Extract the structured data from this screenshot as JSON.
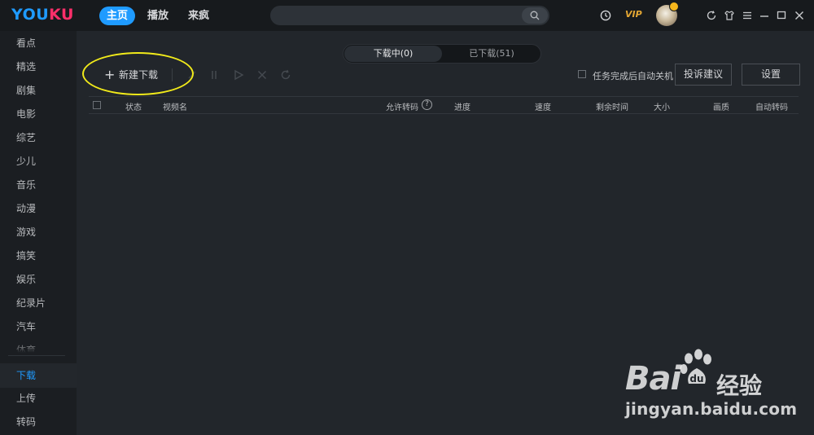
{
  "app": {
    "logo_left": "YOU",
    "logo_right": "KU",
    "brand_blue": "#1f9bff",
    "brand_pink": "#ff2f6a"
  },
  "topnav": {
    "items": [
      {
        "label": "主页",
        "active": true
      },
      {
        "label": "播放",
        "active": false
      },
      {
        "label": "来疯",
        "active": false
      }
    ]
  },
  "search": {
    "placeholder": "",
    "icon": "search-icon"
  },
  "toolbar_right": {
    "history_icon": "clock-icon",
    "vip_label": "VIP",
    "avatar_icon": "avatar",
    "window_icons": [
      "refresh-icon",
      "skin-icon",
      "menu-icon",
      "minimize-icon",
      "maximize-icon",
      "close-icon"
    ]
  },
  "sidebar": {
    "items": [
      {
        "label": "看点"
      },
      {
        "label": "精选"
      },
      {
        "label": "剧集"
      },
      {
        "label": "电影"
      },
      {
        "label": "综艺"
      },
      {
        "label": "少儿"
      },
      {
        "label": "音乐"
      },
      {
        "label": "动漫"
      },
      {
        "label": "游戏"
      },
      {
        "label": "搞笑"
      },
      {
        "label": "娱乐"
      },
      {
        "label": "纪录片"
      },
      {
        "label": "汽车"
      },
      {
        "label": "体育"
      }
    ],
    "bottom_items": [
      {
        "label": "下载",
        "active": true
      },
      {
        "label": "上传",
        "active": false
      },
      {
        "label": "转码",
        "active": false
      }
    ]
  },
  "download": {
    "tabs": [
      {
        "label": "下载中(0)",
        "active": true
      },
      {
        "label": "已下载(51)",
        "active": false
      }
    ],
    "new_download_label": "新建下载",
    "tool_icons": [
      "delete-icon",
      "pause-icon",
      "play-icon",
      "cancel-icon",
      "retry-icon"
    ],
    "auto_shutdown_label": "任务完成后自动关机",
    "auto_shutdown_checked": false,
    "feedback_button": "投诉建议",
    "settings_button": "设置",
    "columns": [
      "状态",
      "视频名",
      "允许转码",
      "进度",
      "速度",
      "剩余时间",
      "大小",
      "画质",
      "自动转码"
    ],
    "help_mark": "?",
    "rows": []
  },
  "watermark": {
    "brand": "Bai",
    "brand_tail": "经验",
    "url": "jingyan.baidu.com"
  }
}
